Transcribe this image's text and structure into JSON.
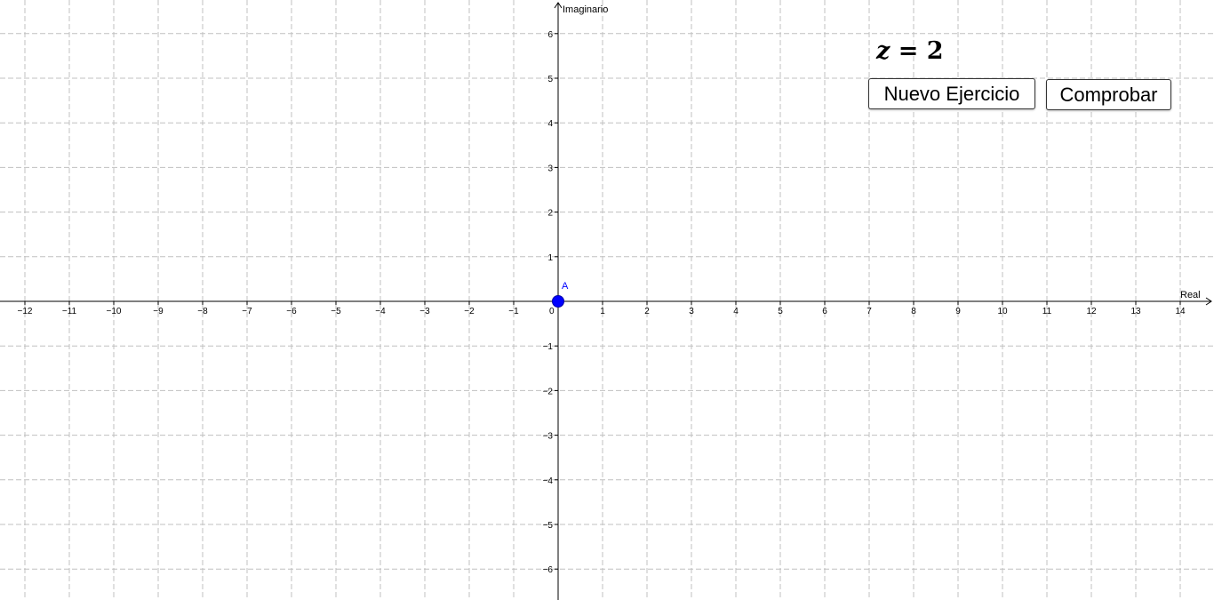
{
  "equation": {
    "variable": "z",
    "operator": "=",
    "value": "2"
  },
  "buttons": {
    "new_exercise": "Nuevo Ejercicio",
    "check": "Comprobar"
  },
  "axes": {
    "x_label": "Real",
    "y_label": "Imaginario",
    "x_range": [
      -12,
      14
    ],
    "y_range": [
      -6,
      6
    ],
    "grid": true
  },
  "point": {
    "label": "A",
    "x": 0,
    "y": 0,
    "color": "#0000ff"
  },
  "colors": {
    "axis": "#000000",
    "grid": "#c0c0c0",
    "point": "#0000ff"
  }
}
